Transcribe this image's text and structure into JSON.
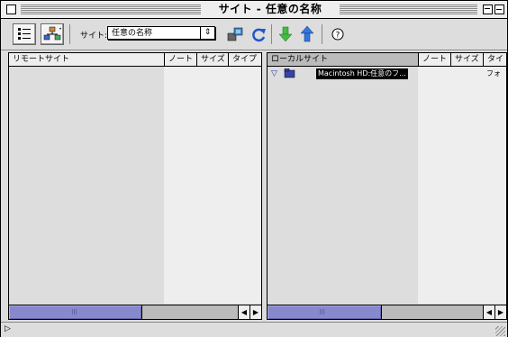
{
  "window": {
    "title": "サイト - 任意の名称"
  },
  "toolbar": {
    "site_label": "サイト:",
    "site_value": "任意の名称",
    "select_arrows": "⇕",
    "help_glyph": "?",
    "refresh_glyph": "↻"
  },
  "remote": {
    "columns": [
      "リモートサイト",
      "ノート",
      "サイズ",
      "タイプ"
    ]
  },
  "local": {
    "columns": [
      "ローカルサイト",
      "ノート",
      "サイズ",
      "タイ"
    ],
    "rows": [
      {
        "disclosure": "▽",
        "name": "Macintosh HD:任意のフ...",
        "kind": "フォ"
      }
    ]
  },
  "scroll": {
    "left_arrow": "◀",
    "right_arrow": "▶"
  },
  "status": {
    "disclosure": "▷"
  },
  "colors": {
    "accent": "#8888cc",
    "sorted_header": "#bbbbbb",
    "window_bg": "#dddddd"
  }
}
